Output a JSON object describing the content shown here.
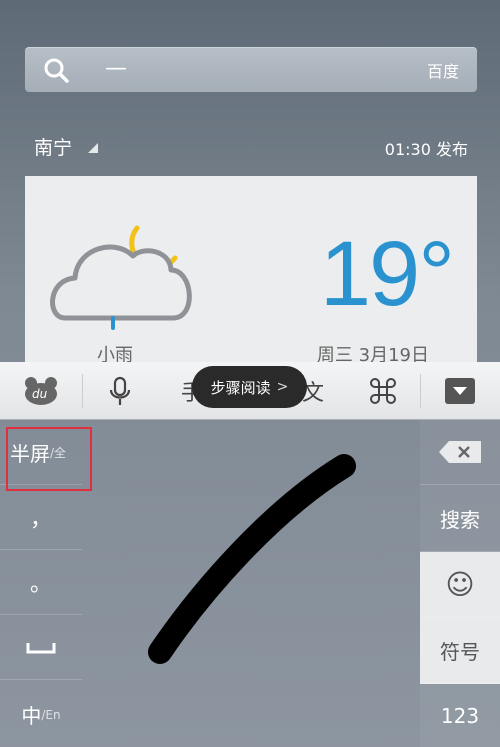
{
  "search": {
    "cursor": "—",
    "engine": "百度"
  },
  "location": {
    "city": "南宁",
    "publish_time": "01:30 发布"
  },
  "weather": {
    "condition": "小雨",
    "temperature": "19°",
    "date": "周三 3月19日"
  },
  "toolbar": {
    "hidden_left_text": "手",
    "hidden_right_text": "文"
  },
  "tooltip": {
    "text": "步骤阅读",
    "chevron": ">"
  },
  "left_keys": {
    "halfscreen": "半屏",
    "halfscreen_sub": "/全",
    "comma": "，",
    "period": "。",
    "space": "⎵",
    "lang": "中",
    "lang_sub": "/En"
  },
  "right_keys": {
    "search": "搜索",
    "emoji": "☺",
    "symbols": "符号",
    "numbers": "123"
  },
  "colors": {
    "temperature": "#2a93cf",
    "highlight": "#e0303d",
    "sun": "#f2c21b"
  }
}
